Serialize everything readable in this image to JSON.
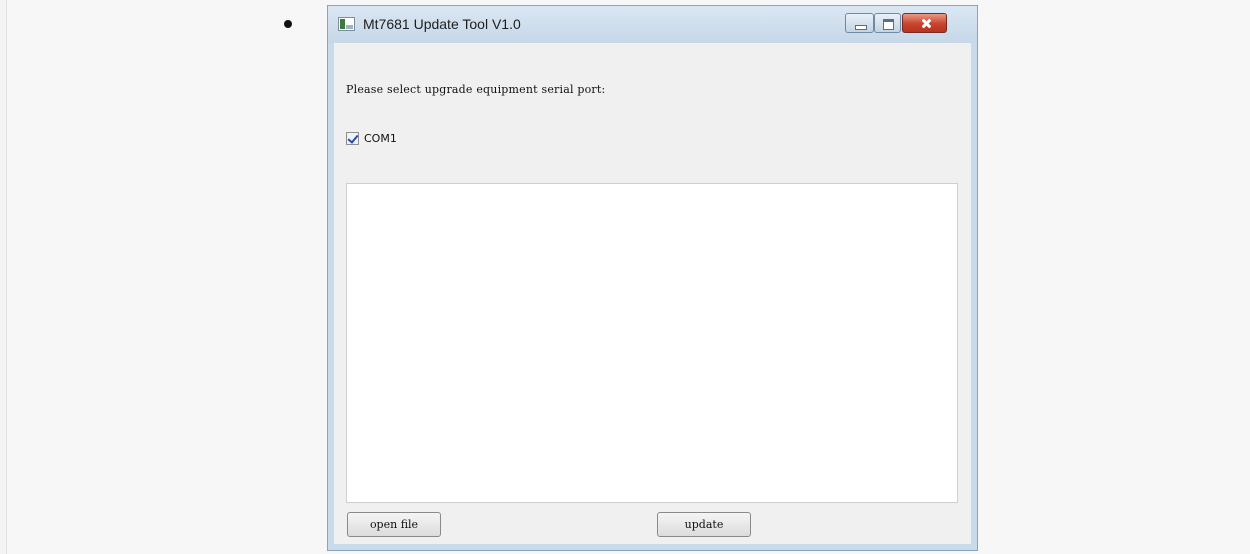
{
  "window": {
    "title": "Mt7681 Update Tool V1.0",
    "icons": [
      "app-icon",
      "minimize-icon",
      "maximize-icon",
      "close-icon"
    ]
  },
  "main": {
    "prompt": "Please select upgrade equipment serial port:",
    "port": {
      "label": "COM1",
      "checked": true
    },
    "log_text": "",
    "open_file_label": "open file",
    "update_label": "update"
  }
}
